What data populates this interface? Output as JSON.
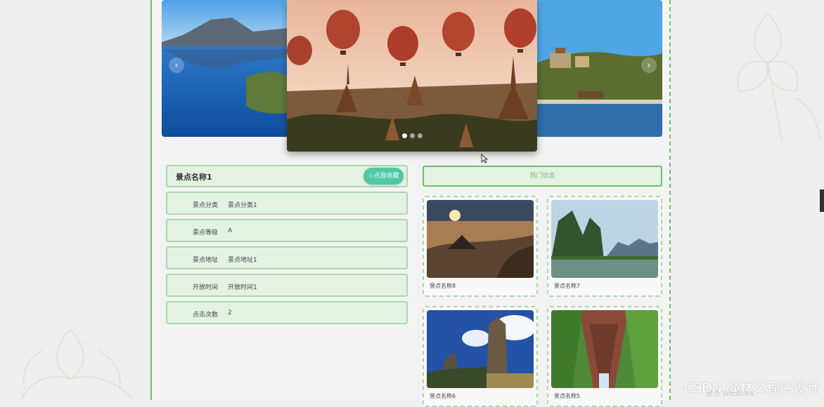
{
  "carousel": {
    "slides": [
      {
        "name": "mountain-lake"
      },
      {
        "name": "hot-air-balloons-temples"
      },
      {
        "name": "summer-palace"
      }
    ],
    "dots": 3,
    "active_dot": 0,
    "prev_icon": "‹",
    "next_icon": "›"
  },
  "detail": {
    "name": "景点名称1",
    "favorite_label": "☆点我收藏",
    "fields": [
      {
        "label": "景点分类",
        "value": "景点分类1"
      },
      {
        "label": "景点等级",
        "value": "A"
      },
      {
        "label": "景点地址",
        "value": "景点地址1"
      },
      {
        "label": "开放时间",
        "value": "开放时间1"
      },
      {
        "label": "点击次数",
        "value": "2"
      }
    ]
  },
  "hot": {
    "header": "热门信息",
    "items": [
      {
        "caption": "景点名称8"
      },
      {
        "caption": "景点名称7"
      },
      {
        "caption": "景点名称6"
      },
      {
        "caption": "景点名称5"
      }
    ]
  },
  "watermark": "CSDN @林文程序设计",
  "windows_text": "激活 Windows",
  "colors": {
    "accent": "#6cbf6c",
    "button": "#4fc9a4",
    "panel": "#e3f2e3"
  }
}
